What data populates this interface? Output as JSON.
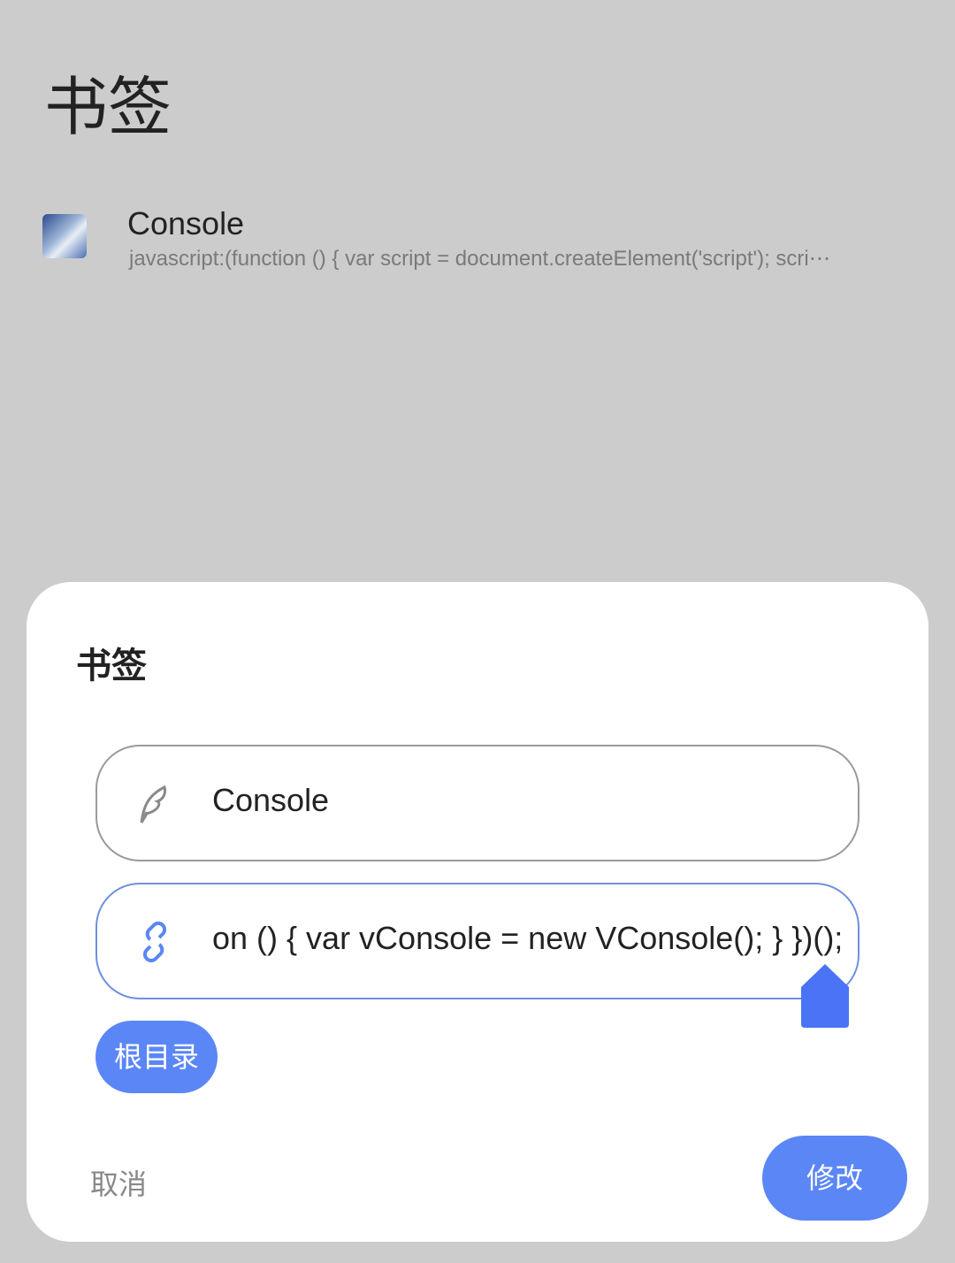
{
  "page": {
    "title": "书签"
  },
  "bookmarks": [
    {
      "name": "Console",
      "url": "javascript:(function () { var script = document.createElement('script'); scri⋯"
    }
  ],
  "dialog": {
    "title": "书签",
    "name_field": {
      "value": "Console",
      "icon": "feather-icon"
    },
    "url_field": {
      "value": "on () { var vConsole = new VConsole(); } })();",
      "icon": "link-icon"
    },
    "folder_chip": "根目录",
    "cancel_label": "取消",
    "confirm_label": "修改"
  },
  "colors": {
    "accent": "#5b86f5",
    "background": "#cccccc"
  }
}
